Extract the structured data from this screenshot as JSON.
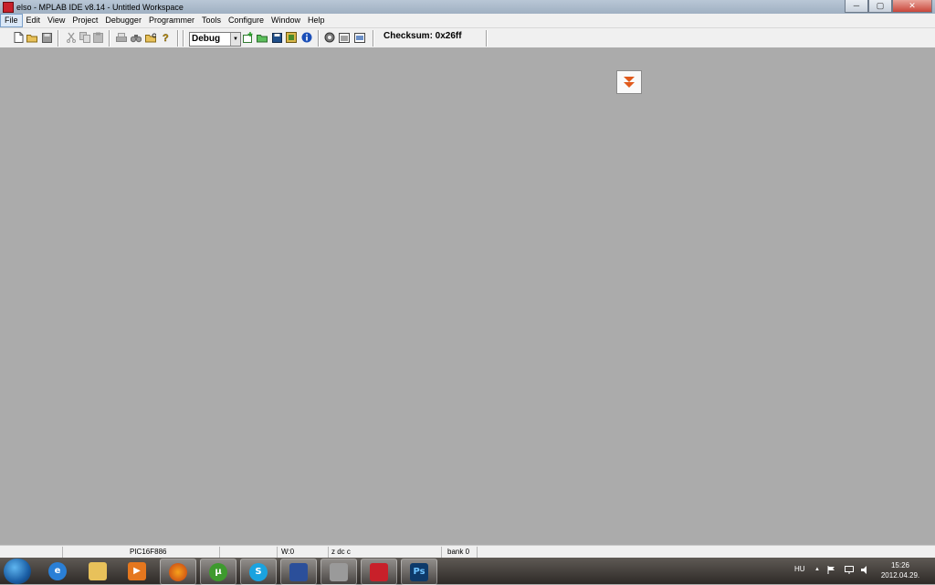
{
  "window": {
    "title": "elso - MPLAB IDE v8.14 - Untitled Workspace"
  },
  "window_controls": {
    "minimize": "─",
    "maximize": "▢",
    "close": "✕"
  },
  "menu": {
    "items": [
      {
        "label": "File",
        "active": true
      },
      {
        "label": "Edit"
      },
      {
        "label": "View"
      },
      {
        "label": "Project"
      },
      {
        "label": "Debugger"
      },
      {
        "label": "Programmer"
      },
      {
        "label": "Tools"
      },
      {
        "label": "Configure"
      },
      {
        "label": "Window"
      },
      {
        "label": "Help"
      }
    ]
  },
  "toolbar": {
    "build_config": "Debug",
    "dropdown_arrow": "▼",
    "checksum": "Checksum:  0x26ff"
  },
  "status_bar": {
    "device": "PIC16F886",
    "w_register": "W:0",
    "flags": "z dc c",
    "bank": "bank 0"
  },
  "tray": {
    "language": "HU",
    "chevron": "▲",
    "time": "15:26",
    "date": "2012.04.29."
  },
  "taskbar_icons": [
    "start-orb-icon",
    "internet-explorer-icon",
    "file-explorer-icon",
    "media-player-icon",
    "firefox-icon",
    "utorrent-icon",
    "skype-icon",
    "floppy-save-icon",
    "device-programmer-icon",
    "mplab-icon",
    "photoshop-icon"
  ],
  "taskbar_glyphs": {
    "ie": "e",
    "media": "▶",
    "utorrent": "µ",
    "skype": "S",
    "ps": "Ps"
  },
  "colors": {
    "workspace_bg": "#ababab",
    "accent_orange": "#e05a1c",
    "titlebar": "#b9c7d6"
  }
}
